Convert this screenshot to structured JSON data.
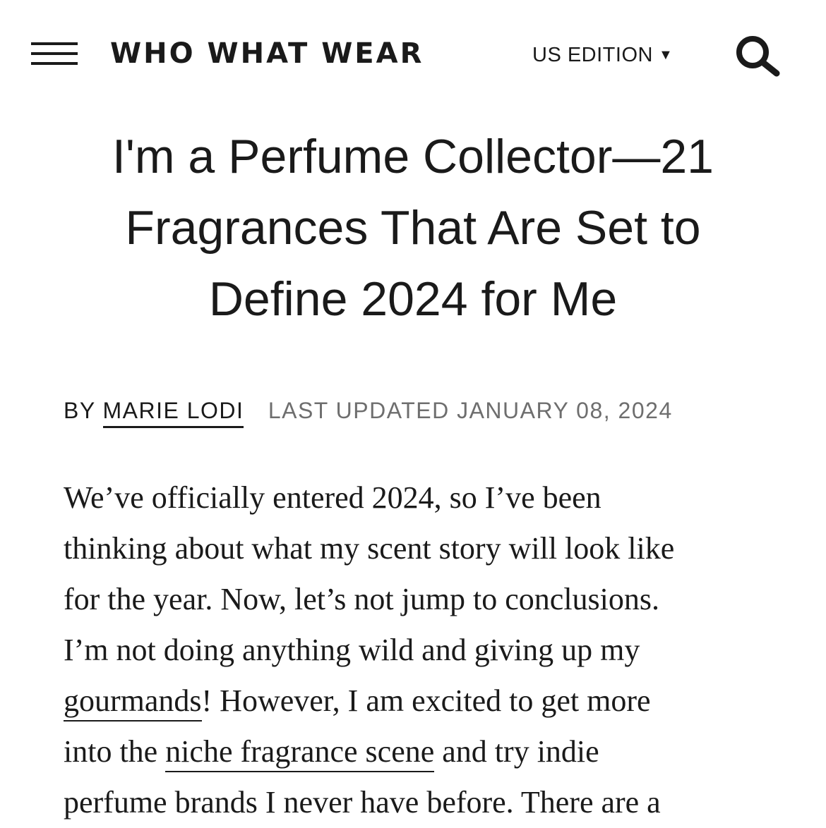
{
  "header": {
    "menu_icon": "hamburger-menu-icon",
    "logo": "WHO WHAT WEAR",
    "edition_label": "US EDITION",
    "edition_caret": "▼",
    "search_icon": "search-icon"
  },
  "article": {
    "title_lines": [
      "I'm a Perfume Collector—21",
      "Fragrances That Are Set to",
      "Define 2024 for Me"
    ],
    "byline": {
      "by": "BY",
      "author": "MARIE LODI",
      "updated": "LAST UPDATED JANUARY 08, 2024"
    },
    "body": {
      "l1": "We’ve officially entered 2024, so I’ve been",
      "l2": "thinking about what my scent story will look like",
      "l3": "for the year. Now, let’s not jump to conclusions.",
      "l4": "I’m not doing anything wild and giving up my",
      "l5_link": "gourmands",
      "l5_rest": "! However, I am excited to get more",
      "l6_pre": "into the ",
      "l6_link": "niche fragrance scene",
      "l6_rest": " and try indie",
      "l7": "perfume brands I never have before. There are a"
    }
  }
}
